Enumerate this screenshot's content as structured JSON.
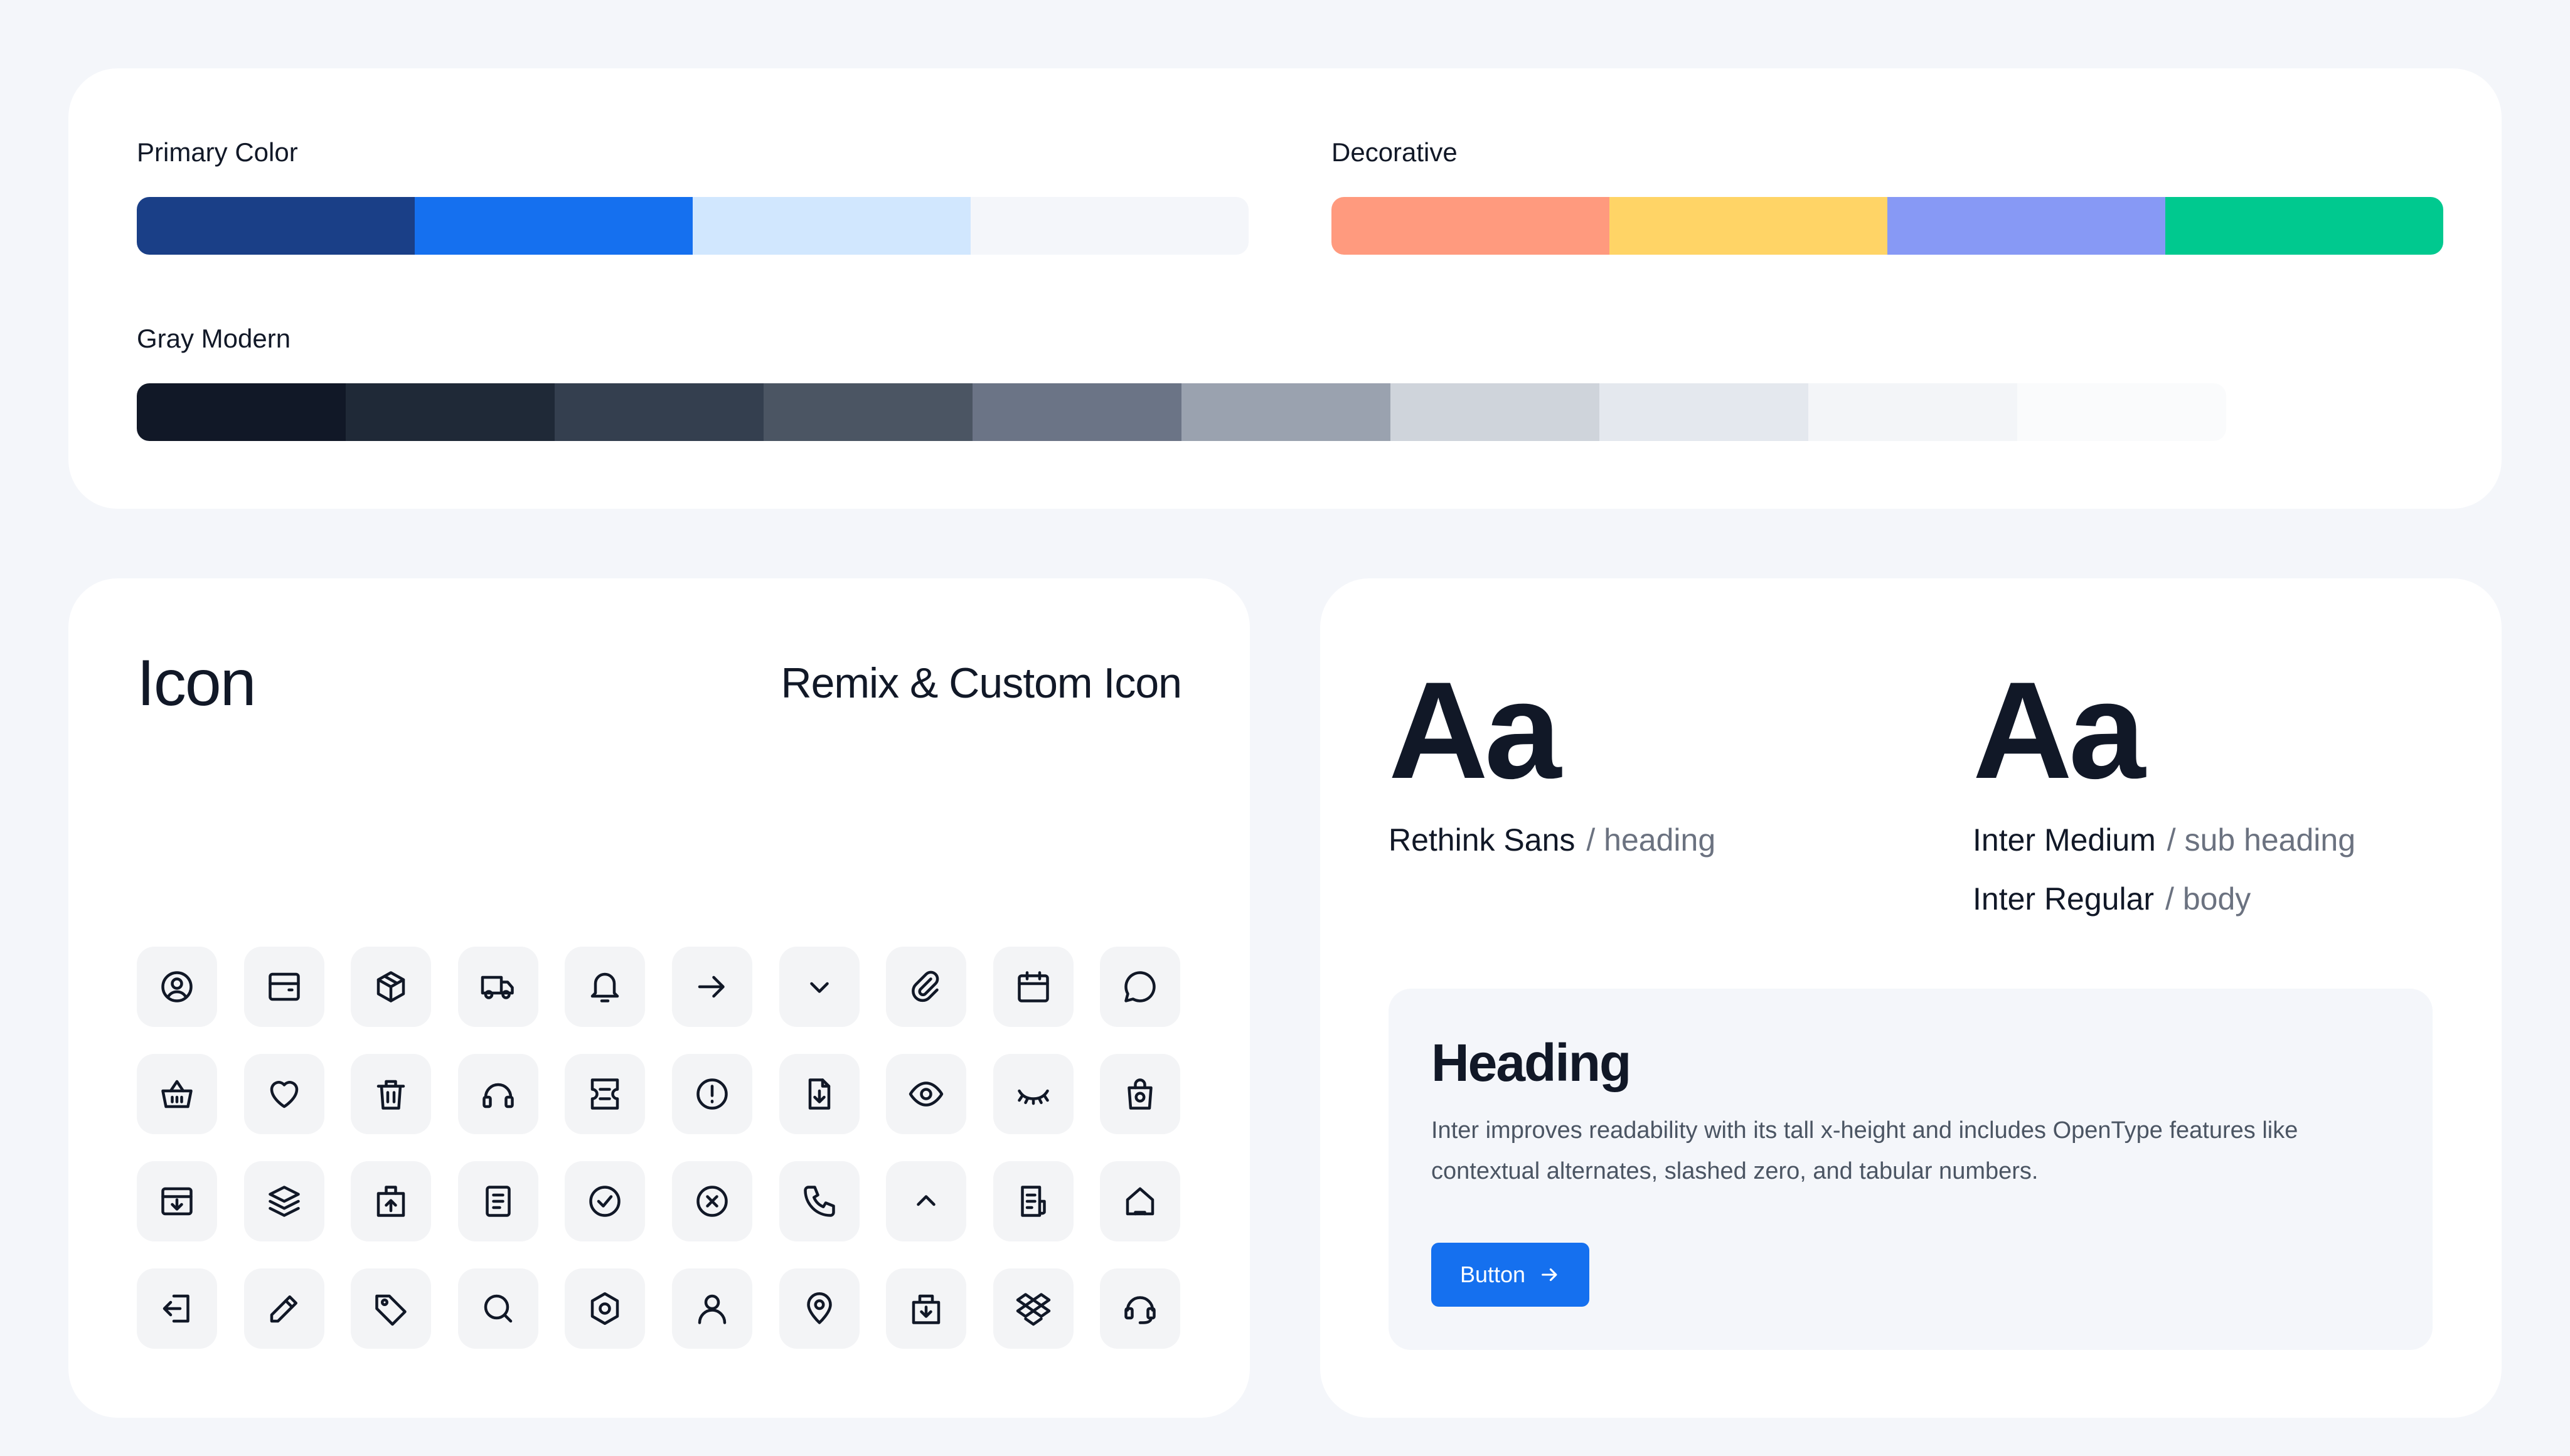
{
  "palette": {
    "primary": {
      "label": "Primary Color",
      "colors": [
        "#1A3F87",
        "#1570EF",
        "#D1E7FE",
        "#F4F6FA"
      ]
    },
    "decorative": {
      "label": "Decorative",
      "colors": [
        "#FF9A7E",
        "#FFD466",
        "#8799F5",
        "#00C98F"
      ]
    },
    "gray": {
      "label": "Gray Modern",
      "colors": [
        "#111827",
        "#1F2937",
        "#343F4F",
        "#4B5563",
        "#6B7486",
        "#9AA2AF",
        "#CFD4DB",
        "#E4E8EE",
        "#F3F5F8",
        "#FAFBFC"
      ]
    }
  },
  "icons": {
    "title": "Icon",
    "subtitle": "Remix & Custom Icon",
    "items": [
      "user-circle-icon",
      "wallet-icon",
      "box-icon",
      "truck-icon",
      "bell-icon",
      "arrow-right-icon",
      "chevron-down-icon",
      "attachment-icon",
      "calendar-icon",
      "chat-bubble-icon",
      "basket-icon",
      "heart-icon",
      "trash-icon",
      "headphones-icon",
      "ticket-icon",
      "alert-circle-icon",
      "file-download-icon",
      "eye-icon",
      "eye-closed-icon",
      "shopping-bag-icon",
      "archive-download-icon",
      "layers-stack-icon",
      "building-upload-icon",
      "file-text-icon",
      "check-circle-icon",
      "close-circle-icon",
      "phone-icon",
      "chevron-up-icon",
      "receipt-icon",
      "home-icon",
      "logout-icon",
      "pencil-icon",
      "tag-icon",
      "search-icon",
      "settings-gear-icon",
      "user-icon",
      "map-pin-icon",
      "package-in-icon",
      "dropbox-icon",
      "customer-service-icon"
    ]
  },
  "typography": {
    "heading_font": {
      "sample": "Aa",
      "name": "Rethink Sans",
      "role": "/ heading"
    },
    "body_font": {
      "sample": "Aa",
      "medium_name": "Inter Medium",
      "medium_role": "/ sub heading",
      "regular_name": "Inter Regular",
      "regular_role": "/ body"
    },
    "sample_card": {
      "heading": "Heading",
      "body": "Inter improves readability with its tall x-height and includes OpenType features like contextual alternates, slashed zero, and tabular numbers.",
      "button_label": "Button",
      "button_icon": "arrow-right-icon"
    }
  }
}
